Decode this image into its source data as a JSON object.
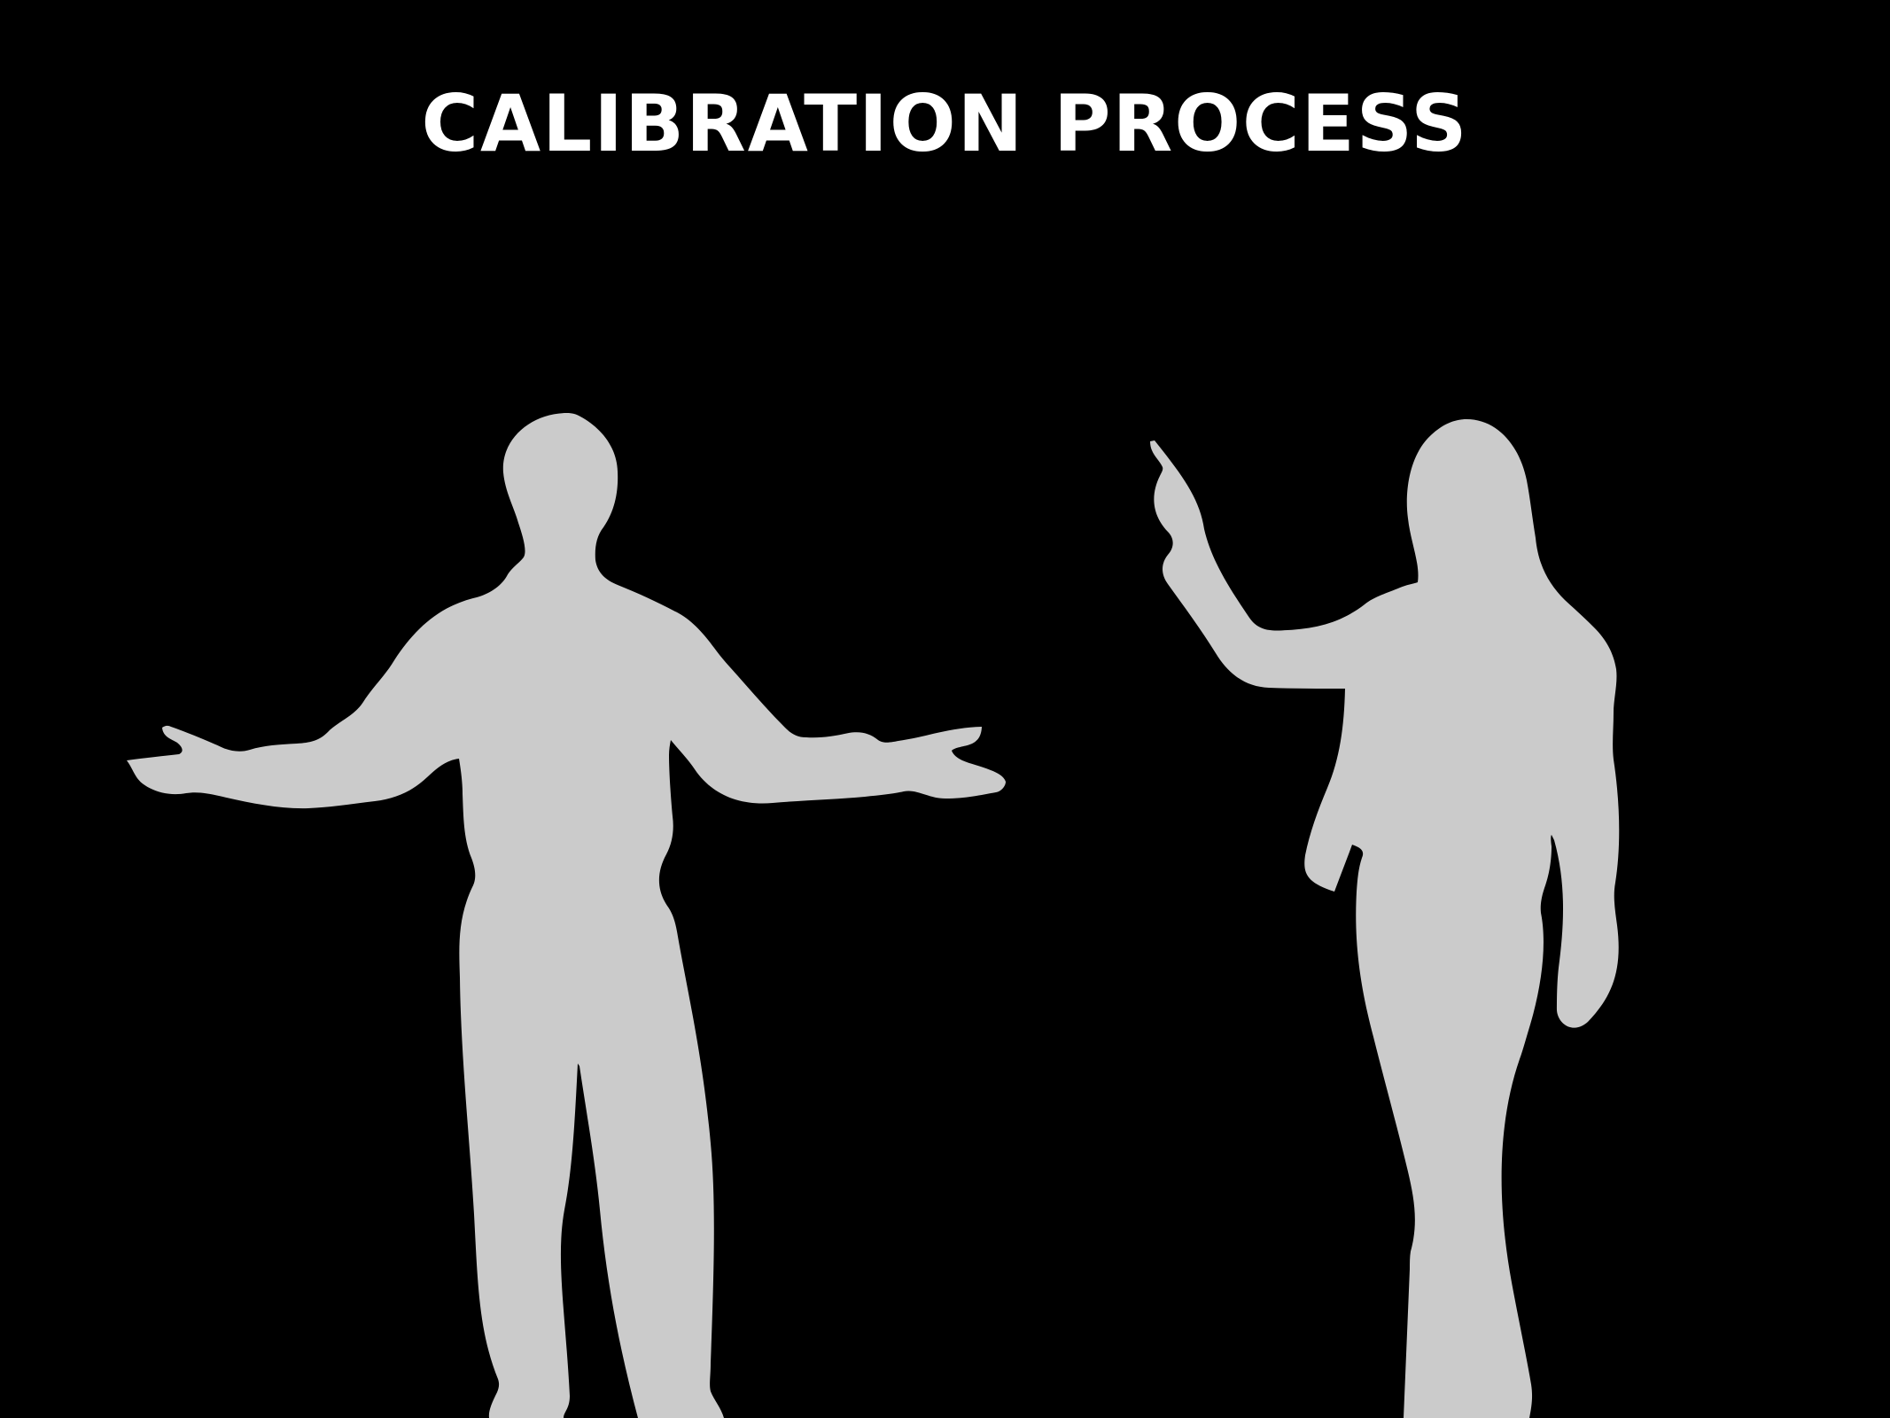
{
  "scene": {
    "title": "CALIBRATION PROCESS",
    "background_color": "#000000",
    "title_color": "#ffffff",
    "silhouette_color": "#cbcbcb"
  },
  "figures": [
    {
      "name": "man-silhouette",
      "pose": "arms-outstretched"
    },
    {
      "name": "woman-silhouette",
      "pose": "hand-raised-pointing"
    }
  ]
}
